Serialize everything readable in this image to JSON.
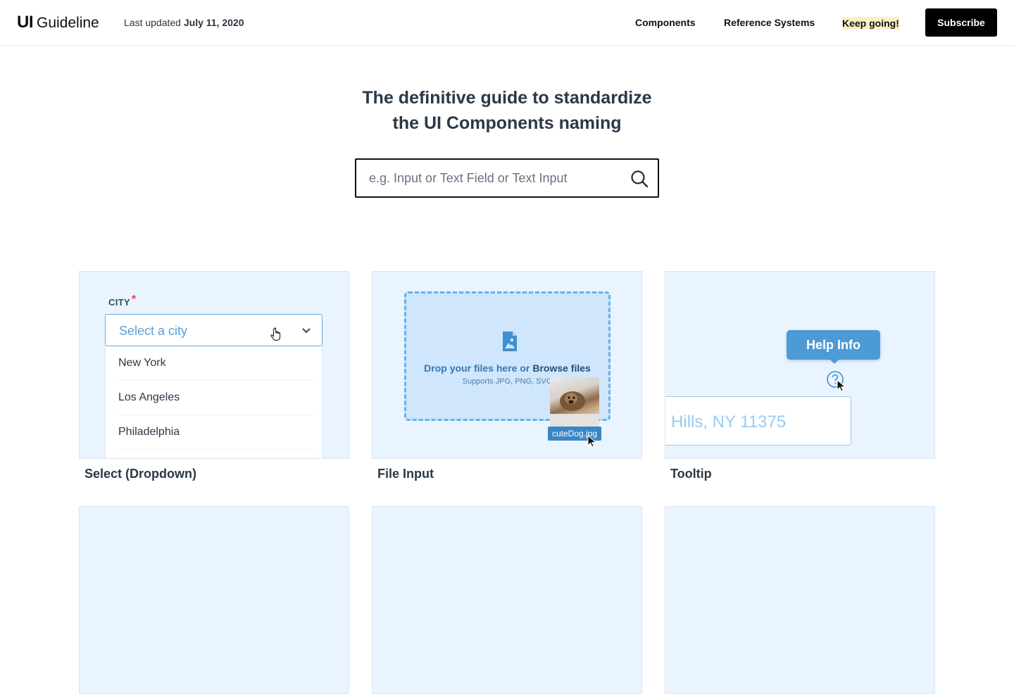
{
  "header": {
    "logo_ui": "UI",
    "logo_name": "Guideline",
    "updated_prefix": "Last updated",
    "updated_date": "July 11, 2020",
    "nav": {
      "components": "Components",
      "reference": "Reference Systems",
      "keep_going": "Keep going!"
    },
    "subscribe_label": "Subscribe"
  },
  "hero": {
    "title_line1": "The definitive guide to standardize",
    "title_line2": "the UI Components naming",
    "search_placeholder": "e.g. Input or Text Field or Text Input",
    "search_icon": "search-icon"
  },
  "cards": [
    {
      "label": "Select (Dropdown)",
      "preview": {
        "field_label": "CITY",
        "required_mark": "*",
        "placeholder": "Select a city",
        "options": [
          "New York",
          "Los Angeles",
          "Philadelphia"
        ]
      }
    },
    {
      "label": "File Input",
      "preview": {
        "drop_text": "Drop your files here or",
        "browse_text": "Browse files",
        "supports": "Supports JPG, PNG, SVG",
        "file_name": "cuteDog.jpg"
      }
    },
    {
      "label": "Tooltip",
      "preview": {
        "tooltip_text": "Help Info",
        "input_value": "Hills, NY 11375"
      }
    }
  ],
  "colors": {
    "card_bg": "#eaf4ff",
    "accent_blue": "#4c9ad6",
    "subscribe_bg": "#000000",
    "highlight": "#fcefc4"
  }
}
